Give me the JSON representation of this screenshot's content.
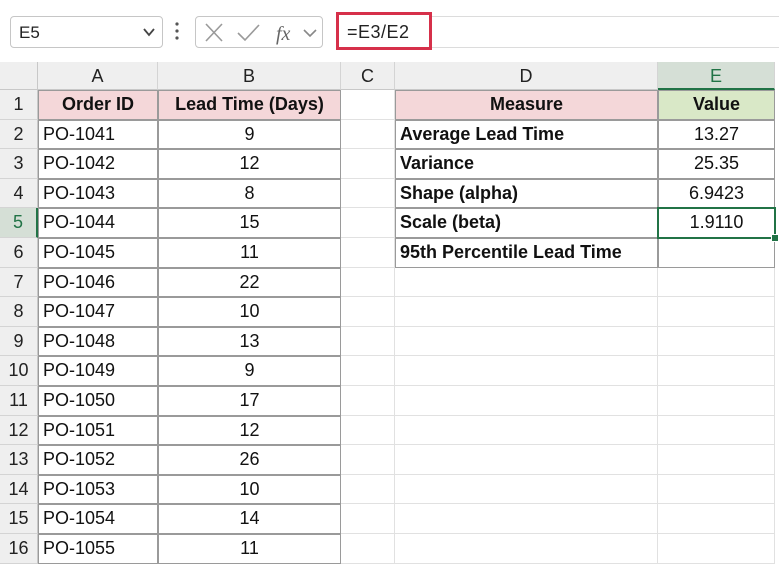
{
  "namebox": {
    "value": "E5"
  },
  "formula": {
    "value": "=E3/E2"
  },
  "columns": [
    "A",
    "B",
    "C",
    "D",
    "E"
  ],
  "selected_column": "E",
  "selected_row": 5,
  "rows": [
    "1",
    "2",
    "3",
    "4",
    "5",
    "6",
    "7",
    "8",
    "9",
    "10",
    "11",
    "12",
    "13",
    "14",
    "15",
    "16"
  ],
  "table_left": {
    "headers": [
      "Order ID",
      "Lead Time (Days)"
    ],
    "data": [
      [
        "PO-1041",
        "9"
      ],
      [
        "PO-1042",
        "12"
      ],
      [
        "PO-1043",
        "8"
      ],
      [
        "PO-1044",
        "15"
      ],
      [
        "PO-1045",
        "11"
      ],
      [
        "PO-1046",
        "22"
      ],
      [
        "PO-1047",
        "10"
      ],
      [
        "PO-1048",
        "13"
      ],
      [
        "PO-1049",
        "9"
      ],
      [
        "PO-1050",
        "17"
      ],
      [
        "PO-1051",
        "12"
      ],
      [
        "PO-1052",
        "26"
      ],
      [
        "PO-1053",
        "10"
      ],
      [
        "PO-1054",
        "14"
      ],
      [
        "PO-1055",
        "11"
      ]
    ]
  },
  "table_right": {
    "headers": [
      "Measure",
      "Value"
    ],
    "data": [
      [
        "Average Lead Time",
        "13.27"
      ],
      [
        "Variance",
        "25.35"
      ],
      [
        "Shape (alpha)",
        "6.9423"
      ],
      [
        "Scale (beta)",
        "1.9110"
      ],
      [
        "95th Percentile Lead Time",
        ""
      ]
    ]
  },
  "colors": {
    "accent": "#217346",
    "header_red": "#f4d7d9",
    "header_green": "#d9e8c7",
    "formula_border": "#d6304a"
  }
}
